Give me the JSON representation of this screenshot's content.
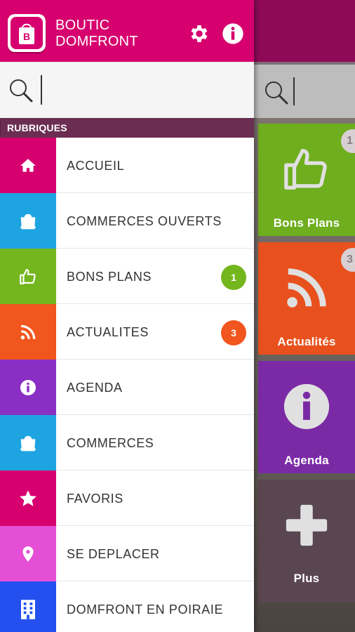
{
  "app": {
    "title_line1": "BOUTIC",
    "title_line2": "DOMFRONT",
    "brand_color": "#d6006e"
  },
  "header": {
    "settings_icon": "gear-icon",
    "info_icon": "info-icon"
  },
  "search": {
    "placeholder": "",
    "value": ""
  },
  "section": {
    "title": "RUBRIQUES"
  },
  "menu": [
    {
      "label": "ACCUEIL",
      "icon": "home-icon",
      "color": "#d6006e",
      "badge": ""
    },
    {
      "label": "COMMERCES OUVERTS",
      "icon": "shopping-bag-icon",
      "color": "#1ea4e0",
      "badge": ""
    },
    {
      "label": "BONS PLANS",
      "icon": "thumbs-up-icon",
      "color": "#74b61e",
      "badge": "1",
      "badge_color": "#74b61e"
    },
    {
      "label": "ACTUALITES",
      "icon": "rss-icon",
      "color": "#f0561e",
      "badge": "3",
      "badge_color": "#f0561e"
    },
    {
      "label": "AGENDA",
      "icon": "info-icon",
      "color": "#8a2fc4",
      "badge": ""
    },
    {
      "label": "COMMERCES",
      "icon": "shopping-bag-icon",
      "color": "#1ea4e0",
      "badge": ""
    },
    {
      "label": "FAVORIS",
      "icon": "star-icon",
      "color": "#d6006e",
      "badge": ""
    },
    {
      "label": "SE DEPLACER",
      "icon": "map-pin-icon",
      "color": "#e44fd6",
      "badge": ""
    },
    {
      "label": "DOMFRONT EN POIRAIE",
      "icon": "building-icon",
      "color": "#2450f0",
      "badge": ""
    }
  ],
  "background_tiles": [
    {
      "label": "Bons Plans",
      "badge": "1",
      "color": "#6fae1e"
    },
    {
      "label": "Actualités",
      "badge": "3",
      "color": "#e8511e"
    },
    {
      "label": "Agenda",
      "badge": "",
      "color": "#7b2aa6"
    },
    {
      "label": "Plus",
      "badge": "",
      "color": "#5a4650"
    }
  ]
}
